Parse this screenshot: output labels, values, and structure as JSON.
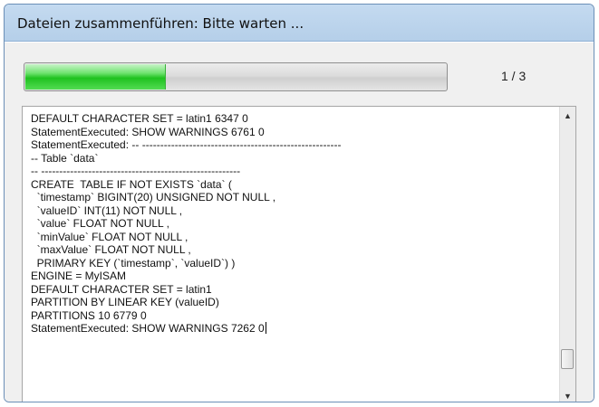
{
  "window": {
    "title": "Dateien zusammenführen: Bitte warten ..."
  },
  "progress": {
    "fraction": 0.33,
    "label": "1 / 3",
    "fill_color": "#2ecc40"
  },
  "log": {
    "lines": [
      "DEFAULT CHARACTER SET = latin1 6347 0",
      "StatementExecuted: SHOW WARNINGS 6761 0",
      "StatementExecuted: -- -------------------------------------------------------",
      "-- Table `data`",
      "-- -------------------------------------------------------",
      "CREATE  TABLE IF NOT EXISTS `data` (",
      "  `timestamp` BIGINT(20) UNSIGNED NOT NULL ,",
      "  `valueID` INT(11) NOT NULL ,",
      "  `value` FLOAT NOT NULL ,",
      "  `minValue` FLOAT NOT NULL ,",
      "  `maxValue` FLOAT NOT NULL ,",
      "  PRIMARY KEY (`timestamp`, `valueID`) )",
      "ENGINE = MyISAM",
      "DEFAULT CHARACTER SET = latin1",
      "PARTITION BY LINEAR KEY (valueID)",
      "PARTITIONS 10 6779 0",
      "StatementExecuted: SHOW WARNINGS 7262 0"
    ]
  },
  "icons": {
    "scroll_up": "scroll-up-arrow-icon",
    "scroll_down": "scroll-down-arrow-icon"
  }
}
